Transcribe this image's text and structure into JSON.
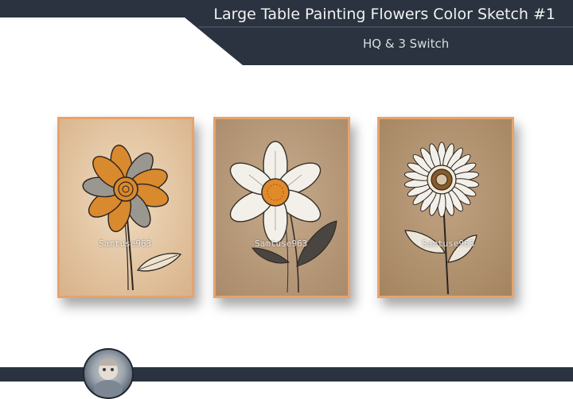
{
  "header": {
    "title": "Large Table Painting Flowers Color Sketch #1",
    "subtitle": "HQ & 3 Switch"
  },
  "colors": {
    "banner": "#2a333f",
    "frame": "#e6a36b",
    "flower_orange": "#d9892e",
    "flower_gray": "#9a9690",
    "petal_white": "#f3f0ea",
    "paper_light": "#e8cfae",
    "paper_kraft": "#b79a7b"
  },
  "paintings": [
    {
      "watermark": "Samtuse963",
      "style": "orange-gray-daisy-on-light-paper"
    },
    {
      "watermark": "Samtuse963",
      "style": "white-petal-flower-on-kraft-paper"
    },
    {
      "watermark": "Samtuse963",
      "style": "white-sunflower-on-kraft-paper"
    }
  ],
  "footer": {
    "avatar": "doll-avatar-icon"
  }
}
